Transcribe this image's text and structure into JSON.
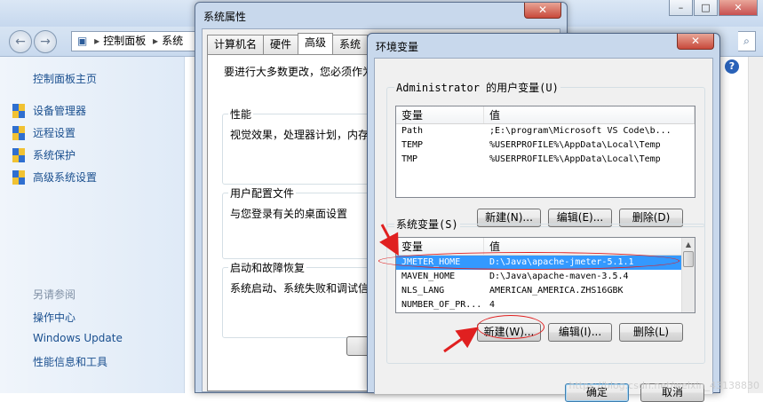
{
  "control_panel": {
    "breadcrumb": [
      "控制面板",
      "系统"
    ],
    "sidebar_home": "控制面板主页",
    "sidebar_items": [
      "设备管理器",
      "远程设置",
      "系统保护",
      "高级系统设置"
    ],
    "see_also_title": "另请参阅",
    "see_also_links": [
      "操作中心",
      "Windows Update",
      "性能信息和工具"
    ],
    "help_glyph": "?"
  },
  "system_properties": {
    "title": "系统属性",
    "close_glyph": "✕",
    "tabs": [
      "计算机名",
      "硬件",
      "高级",
      "系统"
    ],
    "active_tab": "高级",
    "notice": "要进行大多数更改，您必须作为",
    "groups": [
      {
        "title": "性能",
        "desc": "视觉效果，处理器计划，内存"
      },
      {
        "title": "用户配置文件",
        "desc": "与您登录有关的桌面设置"
      },
      {
        "title": "启动和故障恢复",
        "desc": "系统启动、系统失败和调试信"
      }
    ]
  },
  "env_dialog": {
    "title": "环境变量",
    "close_glyph": "✕",
    "user_vars": {
      "title": "Administrator 的用户变量(U)",
      "col_name": "变量",
      "col_value": "值",
      "rows": [
        {
          "name": "Path",
          "value": ";E:\\program\\Microsoft VS Code\\b..."
        },
        {
          "name": "TEMP",
          "value": "%USERPROFILE%\\AppData\\Local\\Temp"
        },
        {
          "name": "TMP",
          "value": "%USERPROFILE%\\AppData\\Local\\Temp"
        }
      ],
      "buttons": {
        "new": "新建(N)...",
        "edit": "编辑(E)...",
        "delete": "删除(D)"
      }
    },
    "system_vars": {
      "title": "系统变量(S)",
      "col_name": "变量",
      "col_value": "值",
      "rows": [
        {
          "name": "JMETER_HOME",
          "value": "D:\\Java\\apache-jmeter-5.1.1",
          "selected": true
        },
        {
          "name": "MAVEN_HOME",
          "value": "D:\\Java\\apache-maven-3.5.4"
        },
        {
          "name": "NLS_LANG",
          "value": "AMERICAN_AMERICA.ZHS16GBK"
        },
        {
          "name": "NUMBER_OF_PR...",
          "value": "4"
        }
      ],
      "buttons": {
        "new": "新建(W)...",
        "edit": "编辑(I)...",
        "delete": "删除(L)"
      }
    },
    "ok": "确定",
    "cancel": "取消"
  },
  "annotation_color": "#e02020",
  "watermark": "https://blog.csdn.net/weixin_43138830"
}
